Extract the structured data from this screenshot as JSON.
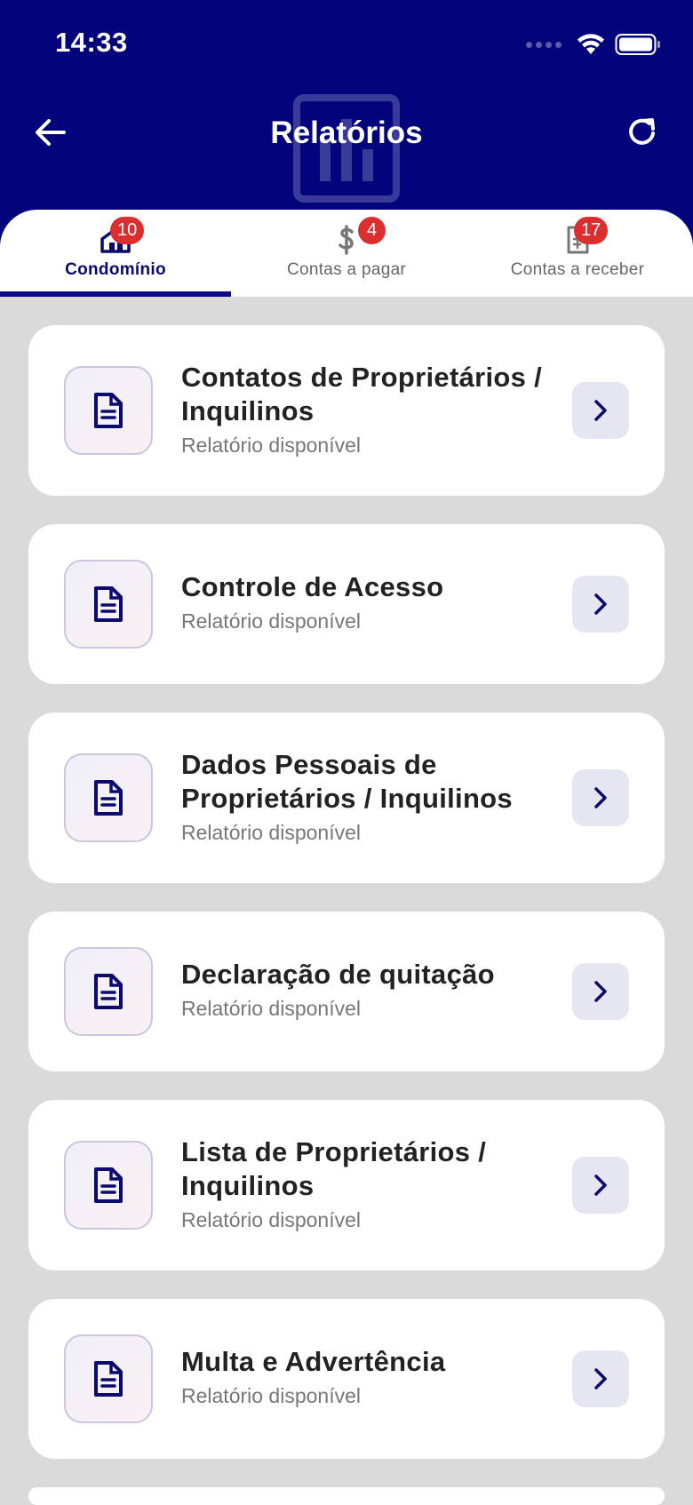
{
  "status_bar": {
    "time": "14:33"
  },
  "header": {
    "title": "Relatórios"
  },
  "tabs": [
    {
      "label": "Condomínio",
      "badge": "10",
      "icon": "home-icon",
      "active": true
    },
    {
      "label": "Contas a pagar",
      "badge": "4",
      "icon": "dollar-icon",
      "active": false
    },
    {
      "label": "Contas a receber",
      "badge": "17",
      "icon": "receipt-icon",
      "active": false
    }
  ],
  "reports": [
    {
      "title": "Contatos de Proprietários / Inquilinos",
      "subtitle": "Relatório disponível"
    },
    {
      "title": "Controle de Acesso",
      "subtitle": "Relatório disponível"
    },
    {
      "title": "Dados Pessoais de Proprietários / Inquilinos",
      "subtitle": "Relatório disponível"
    },
    {
      "title": "Declaração de quitação",
      "subtitle": "Relatório disponível"
    },
    {
      "title": "Lista de Proprietários / Inquilinos",
      "subtitle": "Relatório disponível"
    },
    {
      "title": "Multa e Advertência",
      "subtitle": "Relatório disponível"
    }
  ],
  "colors": {
    "header_bg": "#03037b",
    "badge": "#db2f2f",
    "accent": "#0b0b8a",
    "icon": "#0b0b6e"
  }
}
